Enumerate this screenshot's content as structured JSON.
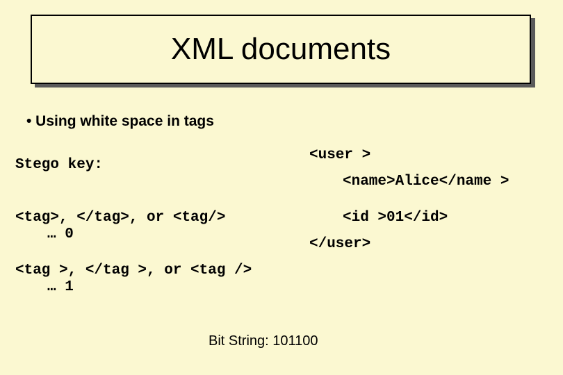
{
  "title": "XML documents",
  "bullet": "•   Using white space in tags",
  "stego_key": "Stego key:",
  "tag0_line": "<tag>, </tag>, or <tag/>",
  "tag0_sub": "… 0",
  "tag1_line": "<tag >, </tag >, or <tag />",
  "tag1_sub": "… 1",
  "xml_user_open": "<user >",
  "xml_name": "<name>Alice</name >",
  "xml_id": "<id >01</id>",
  "xml_user_close": "</user>",
  "bitstring": "Bit String: 101100"
}
